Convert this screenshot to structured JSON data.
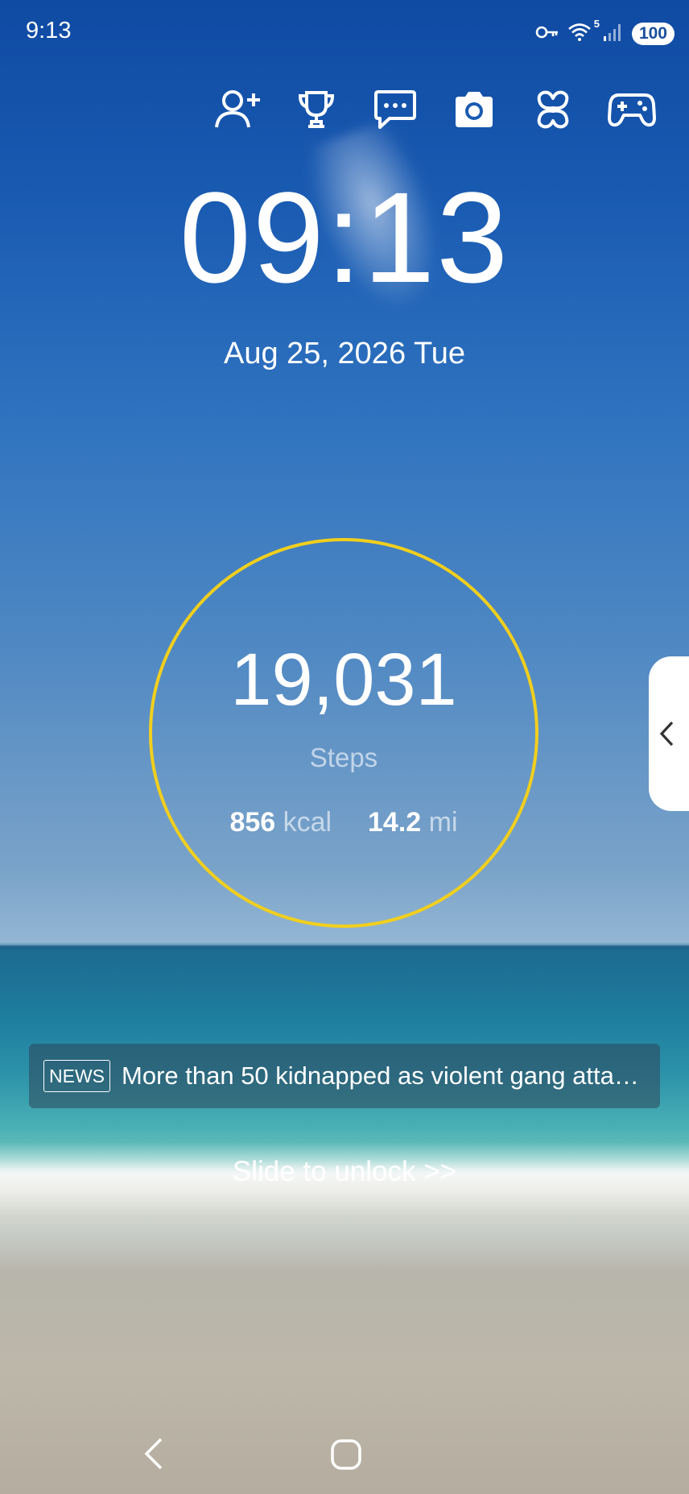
{
  "status_bar": {
    "time": "9:13",
    "wifi_label": "5",
    "battery": "100",
    "icons": [
      "key-icon",
      "wifi-icon",
      "signal-icon",
      "battery-icon"
    ]
  },
  "actions": [
    {
      "name": "add-friend-icon"
    },
    {
      "name": "trophy-icon"
    },
    {
      "name": "message-icon"
    },
    {
      "name": "camera-icon"
    },
    {
      "name": "clover-icon"
    },
    {
      "name": "gamepad-icon"
    }
  ],
  "clock": {
    "time": "09:13",
    "date": "Aug 25, 2026 Tue"
  },
  "steps": {
    "value": "19,031",
    "label": "Steps",
    "kcal_value": "856",
    "kcal_unit": "kcal",
    "distance_value": "14.2",
    "distance_unit": "mi",
    "ring_color": "#f2cf1d"
  },
  "news": {
    "badge": "NEWS",
    "headline": "More than 50 kidnapped as violent gang attac..."
  },
  "unlock": {
    "label": "Slide to unlock >>"
  },
  "navbar": {
    "icons": [
      "back-icon",
      "home-icon"
    ]
  }
}
